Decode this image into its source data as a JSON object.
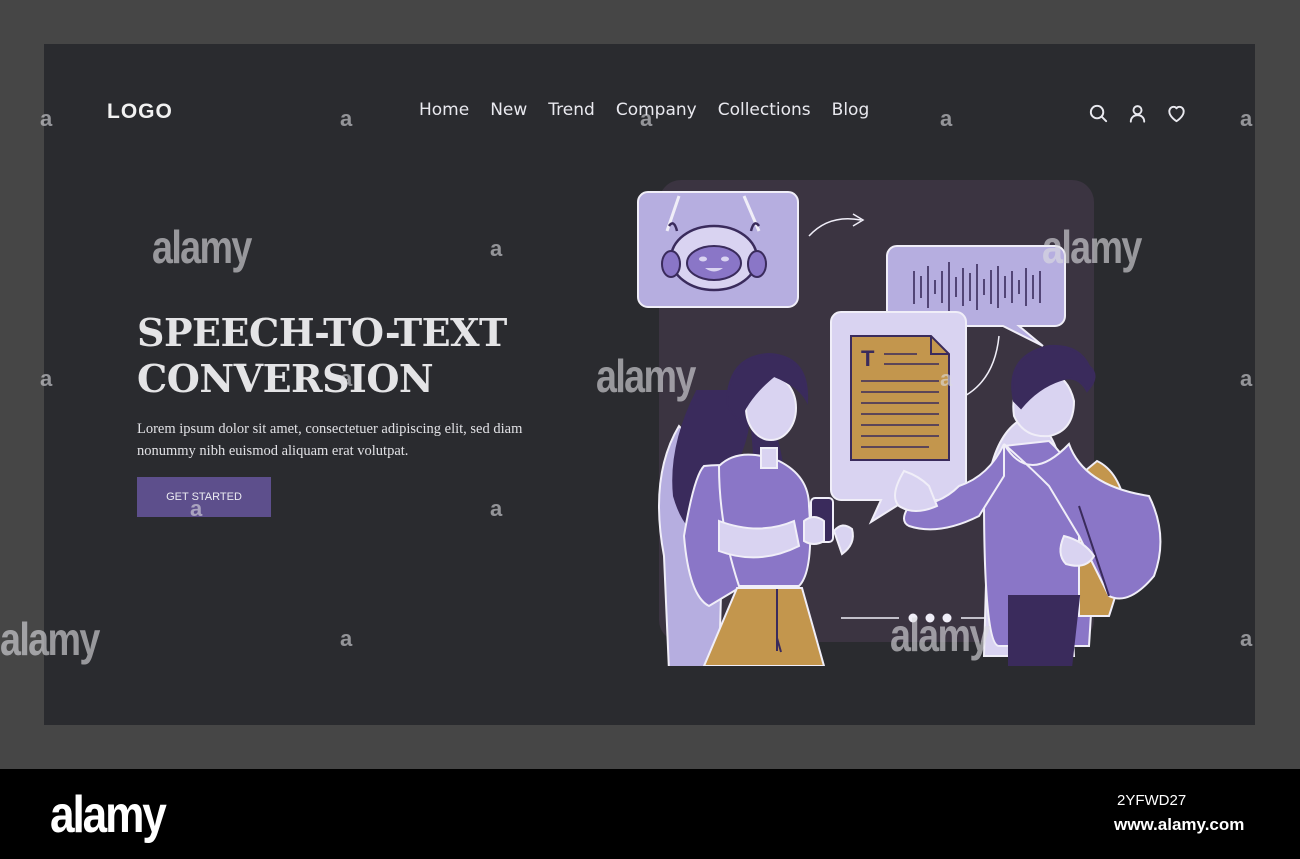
{
  "header": {
    "logo": "LOGO",
    "nav": [
      "Home",
      "New",
      "Trend",
      "Company",
      "Collections",
      "Blog"
    ],
    "icons": [
      "search-icon",
      "user-icon",
      "heart-icon"
    ]
  },
  "hero": {
    "title": "SPEECH-TO-TEXT CONVERSION",
    "description": "Lorem ipsum dolor sit amet, consectetuer adipiscing elit, sed diam nonummy nibh euismod aliquam erat volutpat.",
    "cta_label": "GET STARTED"
  },
  "illustration": {
    "doc_letter": "T"
  },
  "watermark": {
    "text": "alamy",
    "small": "a"
  },
  "footer": {
    "brand": "alamy",
    "image_id": "2YFWD27",
    "url": "www.alamy.com"
  },
  "colors": {
    "background": "#2a2b2f",
    "accent": "#5d4f8c",
    "purple": "#8a76c7",
    "lavender": "#b6aee0",
    "mustard": "#c3964d",
    "dark_purple": "#3a2b5c"
  }
}
